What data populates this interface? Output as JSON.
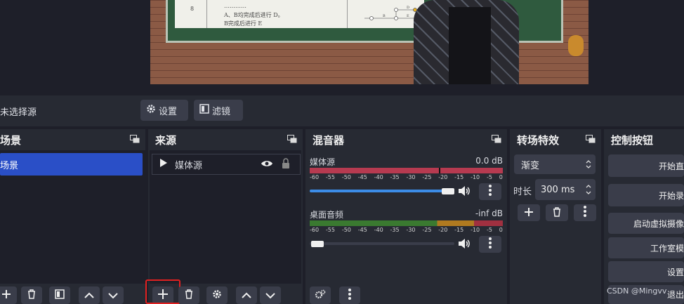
{
  "source_bar": {
    "no_source_label": "未选择源",
    "settings_label": "设置",
    "filters_label": "滤镜"
  },
  "preview": {
    "paper_num": "8",
    "paper_lines": [
      "…………",
      "A、B均完成后进行 D。",
      "B完成后进行 E"
    ],
    "diagram_nodes": [
      "A",
      "B",
      "D",
      "E"
    ]
  },
  "scenes": {
    "title": "场景",
    "items": [
      {
        "label": "场景",
        "selected": true
      }
    ]
  },
  "sources": {
    "title": "来源",
    "items": [
      {
        "label": "媒体源",
        "visible": true,
        "locked": true
      }
    ]
  },
  "mixer": {
    "title": "混音器",
    "channels": [
      {
        "name": "媒体源",
        "level": "0.0 dB",
        "volume_percent": 100,
        "scale": [
          "-60",
          "-55",
          "-50",
          "-45",
          "-40",
          "-35",
          "-30",
          "-25",
          "-20",
          "-15",
          "-10",
          "-5",
          "0"
        ]
      },
      {
        "name": "桌面音频",
        "level": "-inf dB",
        "volume_percent": 5,
        "scale": [
          "-60",
          "-55",
          "-50",
          "-45",
          "-40",
          "-35",
          "-30",
          "-25",
          "-20",
          "-15",
          "-10",
          "-5",
          "0"
        ]
      }
    ]
  },
  "transitions": {
    "title": "转场特效",
    "type_value": "渐变",
    "duration_label": "时长",
    "duration_value": "300 ms"
  },
  "controls": {
    "title": "控制按钮",
    "buttons": [
      "开始直",
      "开始录",
      "启动虚拟摄像",
      "工作室模",
      "设置",
      "退出"
    ]
  },
  "watermark": "CSDN @Mingvv",
  "colors": {
    "accent": "#2a4fc7",
    "highlight": "#e02020",
    "slider": "#3c8ce7"
  }
}
